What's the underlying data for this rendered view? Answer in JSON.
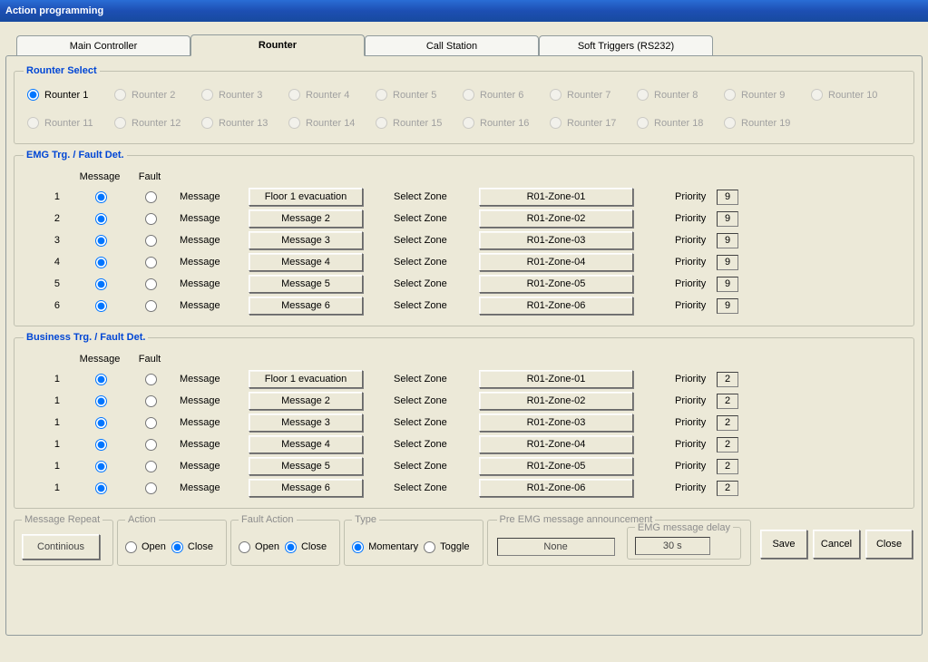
{
  "title": "Action programming",
  "tabs": [
    {
      "label": "Main Controller",
      "active": false
    },
    {
      "label": "Rounter",
      "active": true
    },
    {
      "label": "Call Station",
      "active": false
    },
    {
      "label": "Soft Triggers (RS232)",
      "active": false
    }
  ],
  "router_select": {
    "legend": "Rounter Select",
    "items": [
      {
        "label": "Rounter 1",
        "enabled": true,
        "checked": true
      },
      {
        "label": "Rounter 2",
        "enabled": false,
        "checked": false
      },
      {
        "label": "Rounter 3",
        "enabled": false,
        "checked": false
      },
      {
        "label": "Rounter 4",
        "enabled": false,
        "checked": false
      },
      {
        "label": "Rounter 5",
        "enabled": false,
        "checked": false
      },
      {
        "label": "Rounter 6",
        "enabled": false,
        "checked": false
      },
      {
        "label": "Rounter 7",
        "enabled": false,
        "checked": false
      },
      {
        "label": "Rounter 8",
        "enabled": false,
        "checked": false
      },
      {
        "label": "Rounter 9",
        "enabled": false,
        "checked": false
      },
      {
        "label": "Rounter 10",
        "enabled": false,
        "checked": false
      },
      {
        "label": "Rounter 11",
        "enabled": false,
        "checked": false
      },
      {
        "label": "Rounter 12",
        "enabled": false,
        "checked": false
      },
      {
        "label": "Rounter 13",
        "enabled": false,
        "checked": false
      },
      {
        "label": "Rounter 14",
        "enabled": false,
        "checked": false
      },
      {
        "label": "Rounter 15",
        "enabled": false,
        "checked": false
      },
      {
        "label": "Rounter 16",
        "enabled": false,
        "checked": false
      },
      {
        "label": "Rounter 17",
        "enabled": false,
        "checked": false
      },
      {
        "label": "Rounter 18",
        "enabled": false,
        "checked": false
      },
      {
        "label": "Rounter 19",
        "enabled": false,
        "checked": false
      }
    ]
  },
  "col_headers": {
    "message": "Message",
    "fault": "Fault"
  },
  "row_labels": {
    "message": "Message",
    "select_zone": "Select Zone",
    "priority": "Priority"
  },
  "emg": {
    "legend": "EMG Trg. / Fault Det.",
    "rows": [
      {
        "idx": "1",
        "msg": "Floor 1 evacuation",
        "zone": "R01-Zone-01",
        "priority": "9"
      },
      {
        "idx": "2",
        "msg": "Message 2",
        "zone": "R01-Zone-02",
        "priority": "9"
      },
      {
        "idx": "3",
        "msg": "Message 3",
        "zone": "R01-Zone-03",
        "priority": "9"
      },
      {
        "idx": "4",
        "msg": "Message 4",
        "zone": "R01-Zone-04",
        "priority": "9"
      },
      {
        "idx": "5",
        "msg": "Message 5",
        "zone": "R01-Zone-05",
        "priority": "9"
      },
      {
        "idx": "6",
        "msg": "Message 6",
        "zone": "R01-Zone-06",
        "priority": "9"
      }
    ]
  },
  "biz": {
    "legend": "Business Trg. / Fault Det.",
    "rows": [
      {
        "idx": "1",
        "msg": "Floor 1 evacuation",
        "zone": "R01-Zone-01",
        "priority": "2"
      },
      {
        "idx": "1",
        "msg": "Message 2",
        "zone": "R01-Zone-02",
        "priority": "2"
      },
      {
        "idx": "1",
        "msg": "Message 3",
        "zone": "R01-Zone-03",
        "priority": "2"
      },
      {
        "idx": "1",
        "msg": "Message 4",
        "zone": "R01-Zone-04",
        "priority": "2"
      },
      {
        "idx": "1",
        "msg": "Message 5",
        "zone": "R01-Zone-05",
        "priority": "2"
      },
      {
        "idx": "1",
        "msg": "Message 6",
        "zone": "R01-Zone-06",
        "priority": "2"
      }
    ]
  },
  "bottom": {
    "message_repeat": {
      "legend": "Message Repeat",
      "button": "Continious"
    },
    "action": {
      "legend": "Action",
      "open": "Open",
      "close": "Close",
      "value": "close"
    },
    "fault_action": {
      "legend": "Fault Action",
      "open": "Open",
      "close": "Close",
      "value": "close"
    },
    "type": {
      "legend": "Type",
      "momentary": "Momentary",
      "toggle": "Toggle",
      "value": "momentary"
    },
    "pre_emg": {
      "legend": "Pre EMG message announcement",
      "value": "None",
      "delay_legend": "EMG message delay",
      "delay_value": "30 s"
    }
  },
  "buttons": {
    "save": "Save",
    "cancel": "Cancel",
    "close": "Close"
  }
}
